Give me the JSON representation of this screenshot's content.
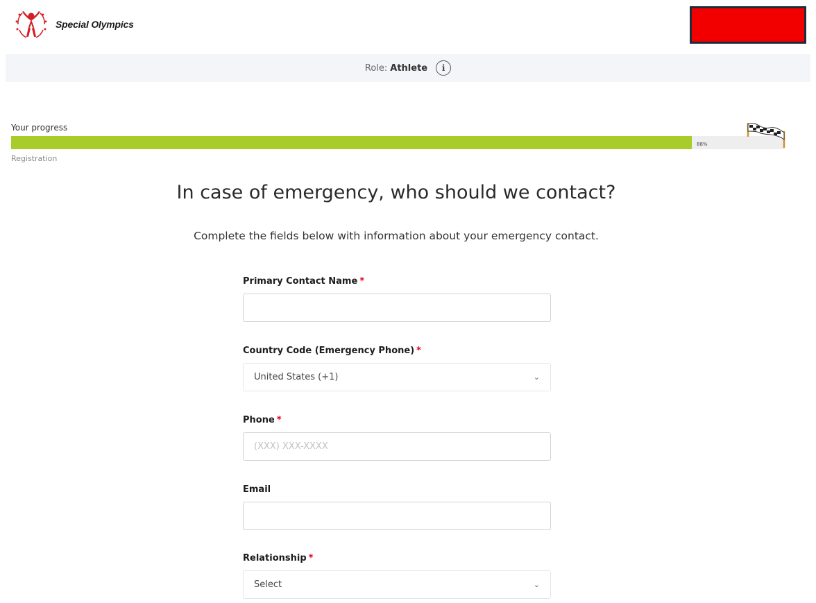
{
  "header": {
    "brand": "Special Olympics",
    "logo_icon": "special-olympics-logo-icon",
    "account_button_color": "#f20000"
  },
  "role_bar": {
    "label": "Role:",
    "value": "Athlete",
    "info_icon": "i"
  },
  "progress": {
    "label": "Your progress",
    "percent_text": "88%",
    "percent": 88,
    "step": "Registration",
    "bar_color": "#a8cc2a"
  },
  "page": {
    "title": "In case of emergency, who should we contact?",
    "subtitle": "Complete the fields below with information about your emergency contact."
  },
  "form": {
    "primary_contact": {
      "label": "Primary Contact Name",
      "required": "*",
      "value": ""
    },
    "country_code": {
      "label": "Country Code (Emergency Phone)",
      "required": "*",
      "value": "United States (+1)"
    },
    "phone": {
      "label": "Phone",
      "required": "*",
      "placeholder": "(XXX) XXX-XXXX"
    },
    "email": {
      "label": "Email",
      "value": ""
    },
    "relationship": {
      "label": "Relationship",
      "required": "*",
      "value": "Select"
    }
  }
}
